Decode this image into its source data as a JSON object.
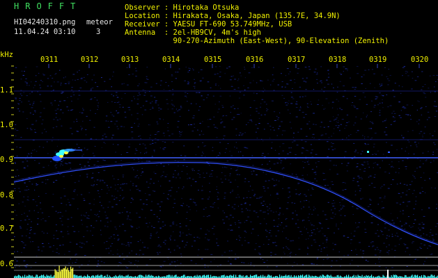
{
  "header": {
    "station": "HROFFT",
    "filename": "HI04240310.png",
    "datetime": "11.04.24 03:10",
    "meteor_label": "meteor",
    "meteor_count": "3",
    "info_lines": [
      "Observer : Hirotaka Otsuka",
      "Location : Hirakata, Osaka, Japan (135.7E, 34.9N)",
      "Receiver : YAESU FT-690 53.749MHz, USB",
      "Antenna  : 2el-HB9CV, 4m's high",
      "           90-270-Azimuth (East-West), 90-Elevation (Zenith)"
    ]
  },
  "axis": {
    "unit": "kHz",
    "time_ticks": [
      "0311",
      "0312",
      "0313",
      "0314",
      "0315",
      "0316",
      "0317",
      "0318",
      "0319",
      "0320"
    ],
    "freq_ticks": [
      "1.1",
      "1.0",
      "0.9",
      "0.8",
      "0.7",
      "0.6"
    ]
  },
  "colors": {
    "background": "#000000",
    "text": "#e8e8e8",
    "accent_yellow": "#f2f200",
    "station_green": "#40e060",
    "noise_blue": "#1a2aa0",
    "signal_cyan": "#40ffff",
    "meteor_head": "#ffff40"
  }
}
